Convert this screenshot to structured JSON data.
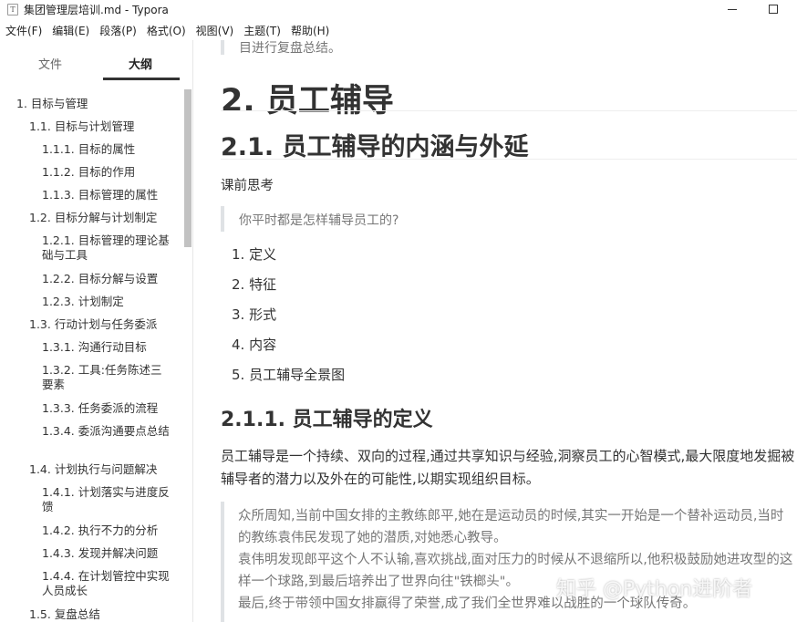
{
  "window": {
    "icon_label": "T",
    "title": "集团管理层培训.md - Typora"
  },
  "menu": [
    "文件(F)",
    "编辑(E)",
    "段落(P)",
    "格式(O)",
    "视图(V)",
    "主题(T)",
    "帮助(H)"
  ],
  "sidebar": {
    "tab_files": "文件",
    "tab_outline": "大纲",
    "active_tab": "大纲",
    "outline": [
      {
        "label": "1. 目标与管理",
        "level": 1
      },
      {
        "label": "1.1. 目标与计划管理",
        "level": 2
      },
      {
        "label": "1.1.1. 目标的属性",
        "level": 3
      },
      {
        "label": "1.1.2. 目标的作用",
        "level": 3
      },
      {
        "label": "1.1.3. 目标管理的属性",
        "level": 3
      },
      {
        "label": "1.2. 目标分解与计划制定",
        "level": 2
      },
      {
        "label": "1.2.1. 目标管理的理论基础与工具",
        "level": 3
      },
      {
        "label": "1.2.2. 目标分解与设置",
        "level": 3
      },
      {
        "label": "1.2.3. 计划制定",
        "level": 3
      },
      {
        "label": "1.3. 行动计划与任务委派",
        "level": 2
      },
      {
        "label": "1.3.1. 沟通行动目标",
        "level": 3
      },
      {
        "label": "1.3.2. 工具:任务陈述三要素",
        "level": 3
      },
      {
        "label": "1.3.3. 任务委派的流程",
        "level": 3
      },
      {
        "label": "1.3.4. 委派沟通要点总结",
        "level": 3
      },
      {
        "label": "1.4. 计划执行与问题解决",
        "level": 2
      },
      {
        "label": "1.4.1. 计划落实与进度反馈",
        "level": 3
      },
      {
        "label": "1.4.2. 执行不力的分析",
        "level": 3
      },
      {
        "label": "1.4.3. 发现并解决问题",
        "level": 3
      },
      {
        "label": "1.4.4. 在计划管控中实现人员成长",
        "level": 3
      },
      {
        "label": "1.5. 复盘总结",
        "level": 2
      }
    ]
  },
  "document": {
    "top_quote_fragment": "目进行复盘总结。",
    "h1": "2. 员工辅导",
    "h2": "2.1. 员工辅导的内涵与外延",
    "pre_class_label": "课前思考",
    "question_quote": "你平时都是怎样辅导员工的?",
    "list": [
      {
        "num": "1.",
        "text": "定义"
      },
      {
        "num": "2.",
        "text": "特征"
      },
      {
        "num": "3.",
        "text": "形式"
      },
      {
        "num": "4.",
        "text": "内容"
      },
      {
        "num": "5.",
        "text": "员工辅导全景图"
      }
    ],
    "h3": "2.1.1. 员工辅导的定义",
    "definition": "员工辅导是一个持续、双向的过程,通过共享知识与经验,洞察员工的心智模式,最大限度地发掘被辅导者的潜力以及外在的可能性,以期实现组织目标。",
    "story_quote": [
      "众所周知,当前中国女排的主教练郎平,她在是运动员的时候,其实一开始是一个替补运动员,当时的教练袁伟民发现了她的潜质,对她悉心教导。",
      "袁伟明发现郎平这个人不认输,喜欢挑战,面对压力的时候从不退缩所以,他积极鼓励她进攻型的这样一个球路,到最后培养出了世界向往\"铁榔头\"。",
      "最后,终于带领中国女排赢得了荣誉,成了我们全世界难以战胜的一个球队传奇。"
    ]
  },
  "watermark": "知乎 @Python进阶者"
}
